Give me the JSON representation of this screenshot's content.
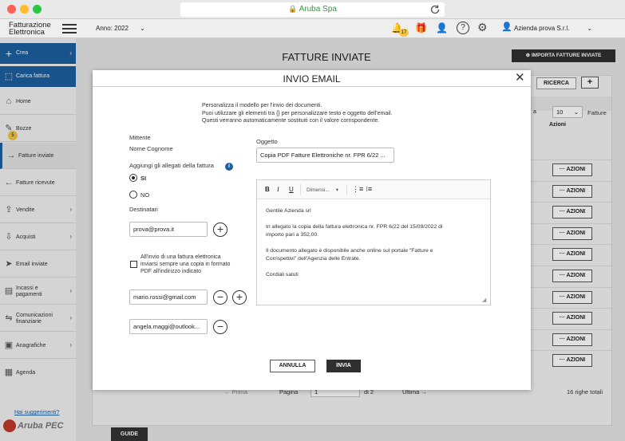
{
  "browser": {
    "url": "Aruba Spa"
  },
  "app": {
    "logo_line1": "Fatturazione",
    "logo_line2": "Elettronica",
    "year_selector": "Anno: 2022",
    "notification_count": "17",
    "company": "Azienda prova S.r.l."
  },
  "sidebar": {
    "items": [
      {
        "label": "Crea"
      },
      {
        "label": "Carica fattura"
      },
      {
        "label": "Home"
      },
      {
        "label": "Bozze",
        "badge": "5"
      },
      {
        "label": "Fatture inviate"
      },
      {
        "label": "Fatture ricevute"
      },
      {
        "label": "Vendite"
      },
      {
        "label": "Acquisti"
      },
      {
        "label": "Email inviate"
      },
      {
        "label": "Incassi e pagamenti"
      },
      {
        "label": "Comunicazioni finanziarie"
      },
      {
        "label": "Anagrafiche"
      },
      {
        "label": "Agenda"
      }
    ],
    "suggestions": "Hai suggerimenti?",
    "brand": "Aruba PEC"
  },
  "page": {
    "title": "FATTURE INVIATE",
    "import_button": "IMPORTA FATTURE INVIATE",
    "search_button": "RICERCA",
    "add_button": "+",
    "per_page_value": "10",
    "per_page_label": "Fatture",
    "col_partial": "a",
    "col_actions": "Azioni",
    "row_action_label": "··· AZIONI",
    "pager_first": "← Prima",
    "pager_page_label": "Pagina",
    "pager_page_value": "1",
    "pager_of": "di 2",
    "pager_last": "Ultima →",
    "total_rows": "16 righe totali",
    "guide_tab": "GUIDE"
  },
  "modal": {
    "title": "INVIO EMAIL",
    "intro_line1": "Personalizza il modello per l'invio dei documenti.",
    "intro_line2": "Puoi utilizzare gli elementi tra {} per personalizzare testo e oggetto dell'email.",
    "intro_line3": "Questi verranno automaticamente sostituiti con il valore corrispondente.",
    "sender_label": "Mittente",
    "sender_name": "Nome Cognome",
    "attach_label": "Aggiungi gli allegati della fattura",
    "radio_yes": "SI",
    "radio_no": "NO",
    "recipients_label": "Destinatari",
    "recipients": [
      "prova@prova.it",
      "mario.rossi@gmail.com",
      "angela.maggi@outlook..."
    ],
    "pdf_copy_line1": "All'invio di una fattura elettronica",
    "pdf_copy_line2": "inviarsi sempre una copia in formato",
    "pdf_copy_line3": "PDF all'indirizzo indicato",
    "subject_label": "Oggetto",
    "subject_value": "Copia PDF Fatture Elettroniche nr. FPR 6/22 ...",
    "font_size_select": "Dimensi...",
    "body_p1": "Gentile Azienda srl",
    "body_p2_line1": "In allegato la copia della fattura elettronica nr. FPR 6/22 del 15/09/2022 di",
    "body_p2_line2": "importo pari a 352,00.",
    "body_p3_line1": "Il documento allegato è disponibile anche online sul portale \"Fatture e",
    "body_p3_line2": "Corrispettivi\" dell'Agenzia delle Entrate.",
    "body_p4": "Cordiali saluti",
    "cancel_button": "ANNULLA",
    "send_button": "INVIA"
  }
}
